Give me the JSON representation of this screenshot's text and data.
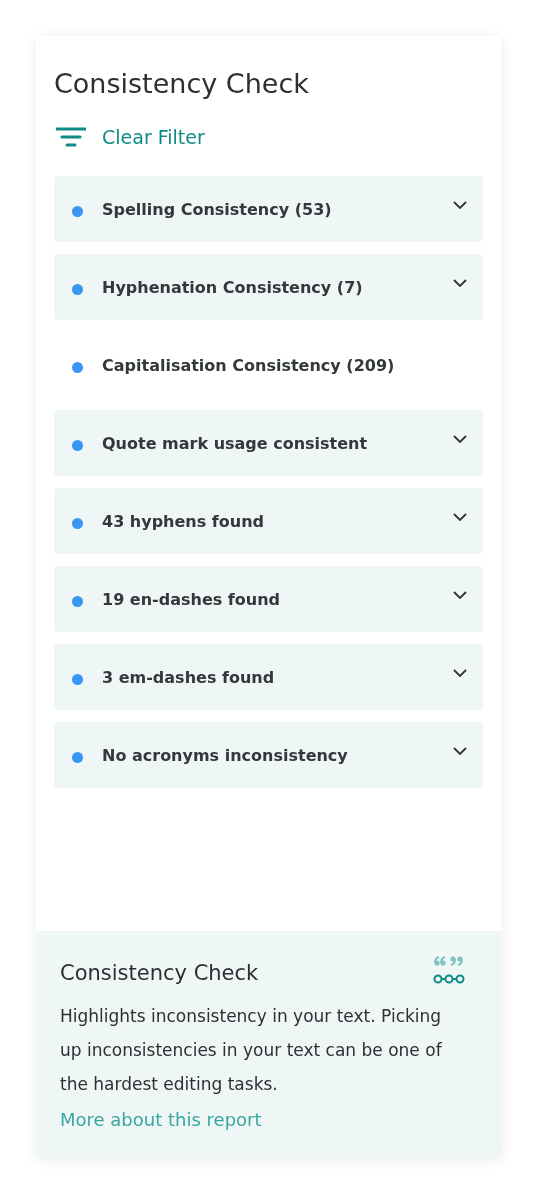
{
  "panel": {
    "title": "Consistency Check",
    "filter_button": "Clear Filter"
  },
  "items": [
    {
      "label": "Spelling Consistency (53)",
      "kind": "expandable"
    },
    {
      "label": "Hyphenation Consistency (7)",
      "kind": "expandable"
    },
    {
      "label": "Capitalisation Consistency (209)",
      "kind": "plain"
    },
    {
      "label": "Quote mark usage consistent",
      "kind": "expandable"
    },
    {
      "label": "43 hyphens found",
      "kind": "expandable"
    },
    {
      "label": "19 en-dashes found",
      "kind": "expandable"
    },
    {
      "label": "3 em-dashes found",
      "kind": "expandable"
    },
    {
      "label": "No acronyms inconsistency",
      "kind": "expandable"
    }
  ],
  "info": {
    "title": "Consistency Check",
    "description": "Highlights inconsistency in your text. Picking up inconsistencies in your text can be one of the hardest editing tasks.",
    "link": "More about this report"
  }
}
